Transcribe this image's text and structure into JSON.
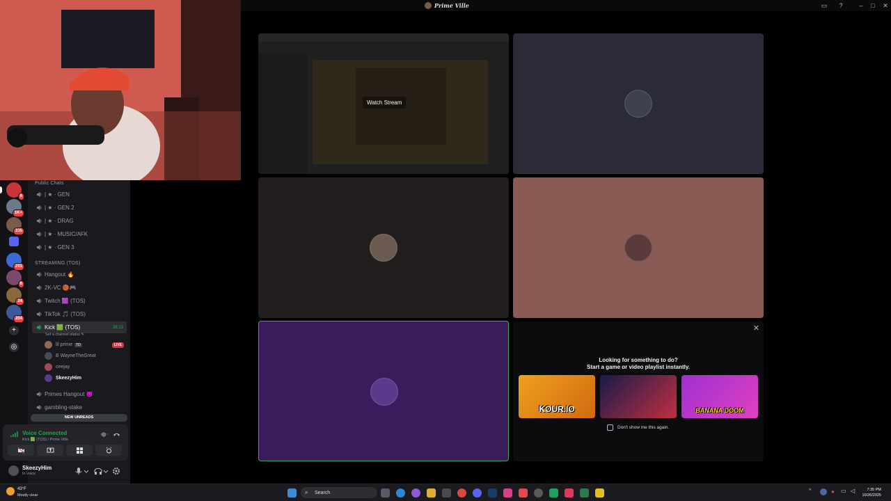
{
  "app": {
    "title": "Prime Ville"
  },
  "servers": [
    {
      "badge": "6",
      "color": "#c9333a"
    },
    {
      "badge": "1K+",
      "color": "#6b7a8c"
    },
    {
      "badge": "335",
      "color": "#7a5a4a"
    },
    {
      "badge": "",
      "color": "#5865f2"
    },
    {
      "badge": "201",
      "color": "#3a6bd4"
    },
    {
      "badge": "6",
      "color": "#7a4a6a"
    },
    {
      "badge": "24",
      "color": "#8a6a3a"
    },
    {
      "badge": "204",
      "color": "#3a5a9a"
    }
  ],
  "categories": {
    "public": "Public Chats",
    "streaming": "STREAMING (TOS)"
  },
  "channels_public": [
    {
      "name": "| ★ · GEN"
    },
    {
      "name": "| ★ · GEN 2"
    },
    {
      "name": "| ★ · DRAG"
    },
    {
      "name": "| ★ · MUSIC/AFK"
    },
    {
      "name": "| ★ · GEN 3"
    }
  ],
  "channels_streaming": [
    {
      "name": "Hangout 🔥"
    },
    {
      "name": "2K-VC 🏀🎮"
    },
    {
      "name": "Twitch 🟪 (TOS)"
    },
    {
      "name": "TikTok 🎵 (TOS)"
    }
  ],
  "active_channel": {
    "name": "Kick 🟩 (TOS)",
    "timer": "38:13",
    "status": "Set a channel status ✎"
  },
  "voice_users": [
    {
      "name": "lil prime",
      "tag": "TD",
      "live": "LIVE",
      "color": "#8a6b5a"
    },
    {
      "name": "B WayneTheGreat",
      "tag": "",
      "live": "",
      "color": "#4a4a52"
    },
    {
      "name": "ceejay",
      "tag": "",
      "live": "",
      "color": "#a04a55"
    },
    {
      "name": "SkeezyHim",
      "tag": "",
      "live": "",
      "color": "#5a3a8a"
    }
  ],
  "channels_after": [
    {
      "name": "Primes Hangout 😈"
    },
    {
      "name": "gambling-stake"
    }
  ],
  "new_unreads": "NEW UNREADS",
  "voice": {
    "status": "Voice Connected",
    "location": "Kick 🟩 (TOS) / Prime Ville"
  },
  "user": {
    "name": "SkeezyHim",
    "status": "In voice"
  },
  "stream_tile": {
    "label": "Watch Stream"
  },
  "activity": {
    "title": "Looking for something to do?",
    "subtitle": "Start a game or video playlist instantly.",
    "games": [
      {
        "name": "KOUR.IO"
      },
      {
        "name": ""
      },
      {
        "name": "BANANA DOOM"
      }
    ],
    "dont_show": "Don't show me this again.",
    "close": "✕"
  },
  "taskbar": {
    "weather_temp": "43°F",
    "weather_desc": "Mostly clear",
    "search": "Search",
    "time": "7:35 PM",
    "date": "10/26/2025"
  }
}
